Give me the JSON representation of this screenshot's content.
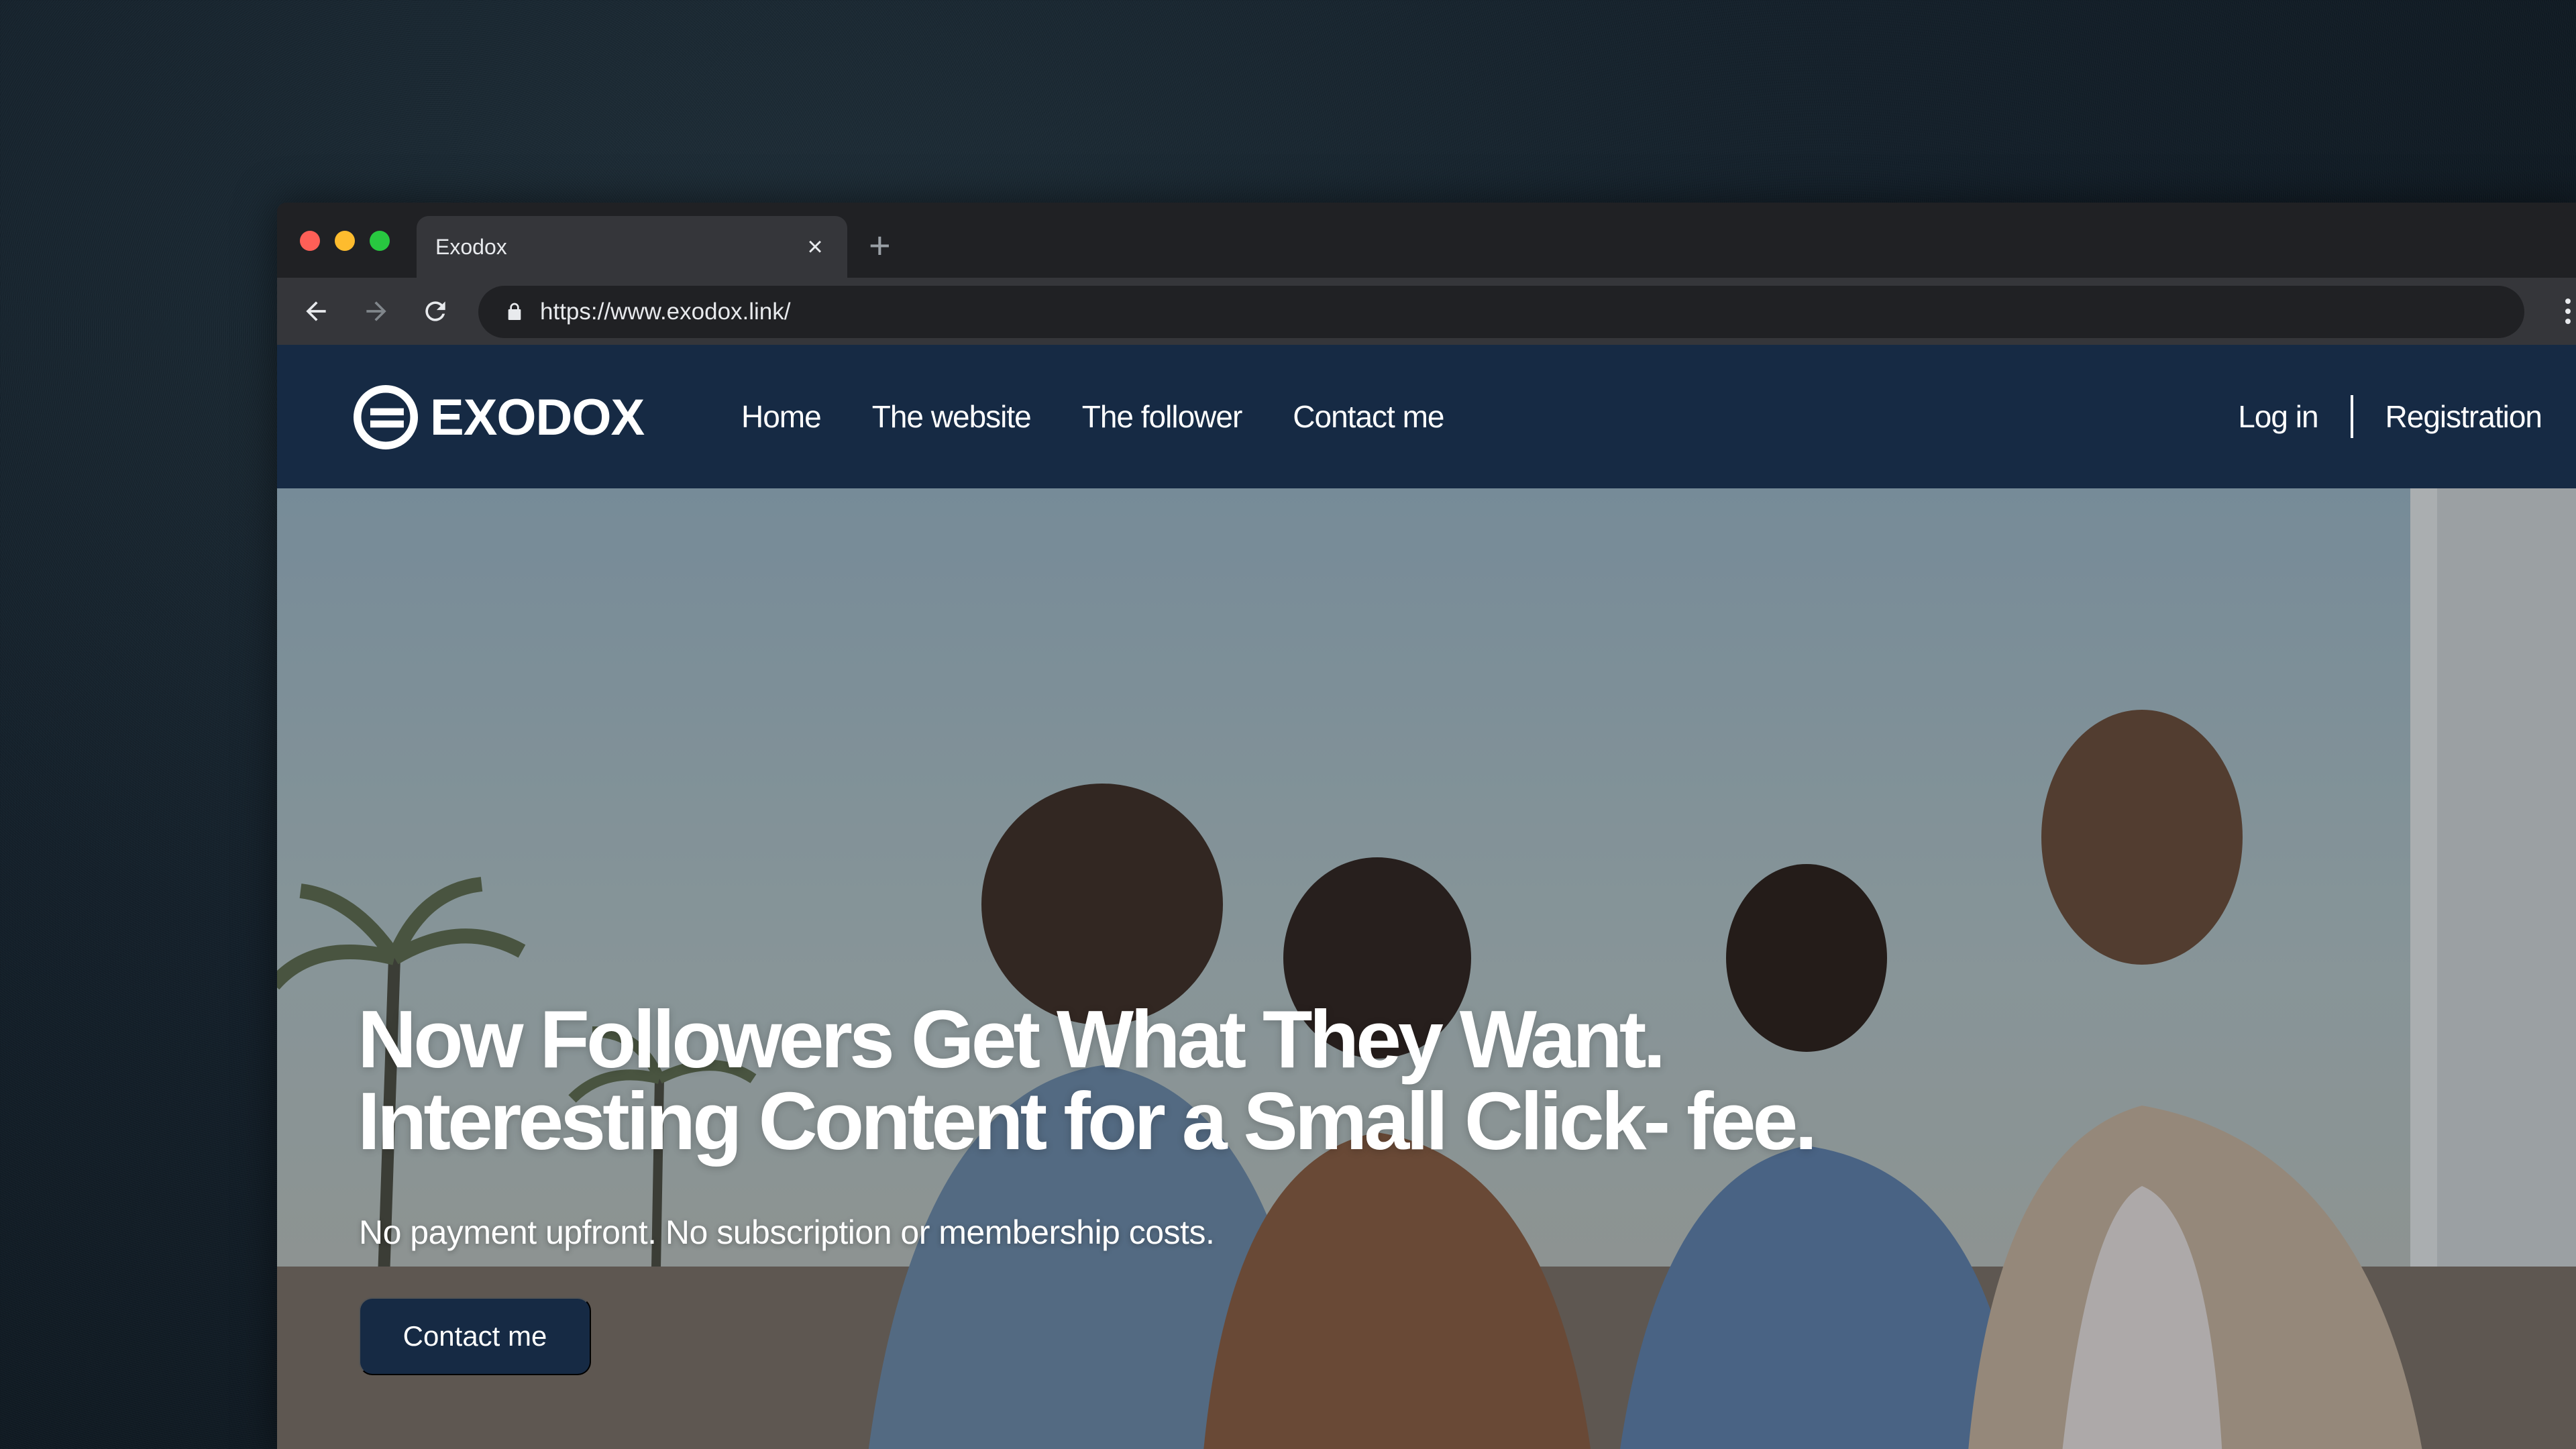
{
  "browser": {
    "tab": {
      "title": "Exodox"
    },
    "address_bar": {
      "url": "https://www.exodox.link/"
    },
    "icons": [
      "close-icon",
      "plus-icon",
      "arrow-left-icon",
      "arrow-right-icon",
      "reload-icon",
      "lock-icon",
      "kebab-menu-icon"
    ]
  },
  "site": {
    "logo_text": "EXODOX",
    "nav": [
      {
        "label": "Home"
      },
      {
        "label": "The website"
      },
      {
        "label": "The follower"
      },
      {
        "label": "Contact me"
      }
    ],
    "auth": {
      "login": "Log in",
      "register": "Registration"
    },
    "hero": {
      "title_line1": "Now Followers Get What They Want.",
      "title_line2": "Interesting Content for a Small Click- fee.",
      "subtitle": "No payment upfront. No subscription or membership costs.",
      "cta": "Contact me"
    }
  },
  "colors": {
    "nav_background": "#162a44",
    "cta_background": "#162a44",
    "traffic_red": "#fe5f57",
    "traffic_yellow": "#febc2e",
    "traffic_green": "#28c840"
  }
}
